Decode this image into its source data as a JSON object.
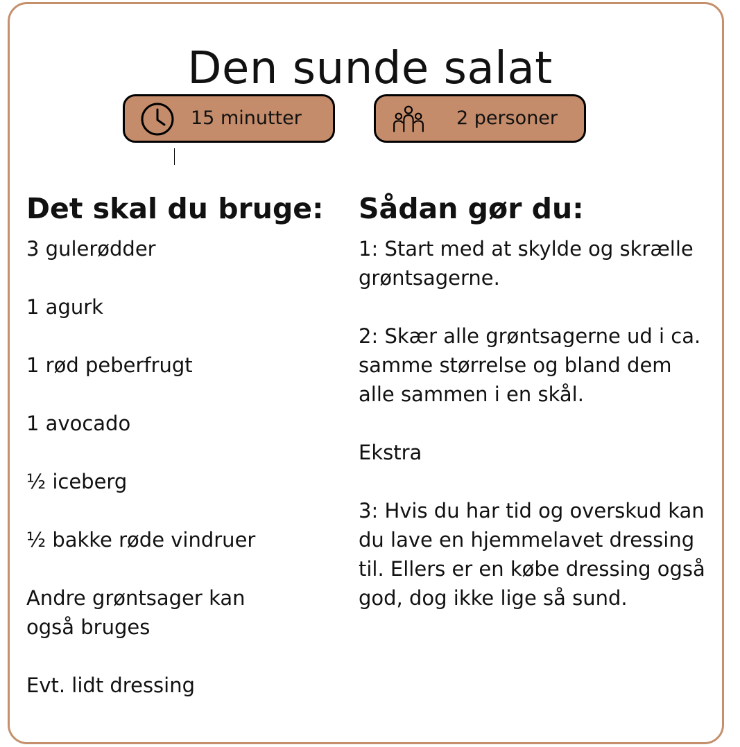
{
  "title": "Den sunde salat",
  "colors": {
    "accent": "#c48c6a",
    "border": "#c4906c",
    "text": "#111111"
  },
  "badges": [
    {
      "icon": "clock-icon",
      "label": "15 minutter"
    },
    {
      "icon": "people-icon",
      "label": "2 personer"
    }
  ],
  "ingredients": {
    "heading": "Det skal du bruge:",
    "items": [
      "3 gulerødder",
      "1 agurk",
      "1 rød peberfrugt",
      "1 avocado",
      "½ iceberg",
      "½ bakke røde vindruer",
      "Andre grøntsager kan\nogså bruges",
      "Evt. lidt dressing"
    ]
  },
  "steps": {
    "heading": "Sådan gør du:",
    "items": [
      "1: Start med at skylde og skrælle grøntsagerne.",
      "2: Skær alle grøntsagerne ud i ca. samme størrelse og bland dem alle sammen i en skål.",
      "Ekstra",
      "3: Hvis du har tid og overskud kan du lave en hjemmelavet dressing til. Ellers er en købe dressing også god, dog ikke lige så sund."
    ]
  }
}
